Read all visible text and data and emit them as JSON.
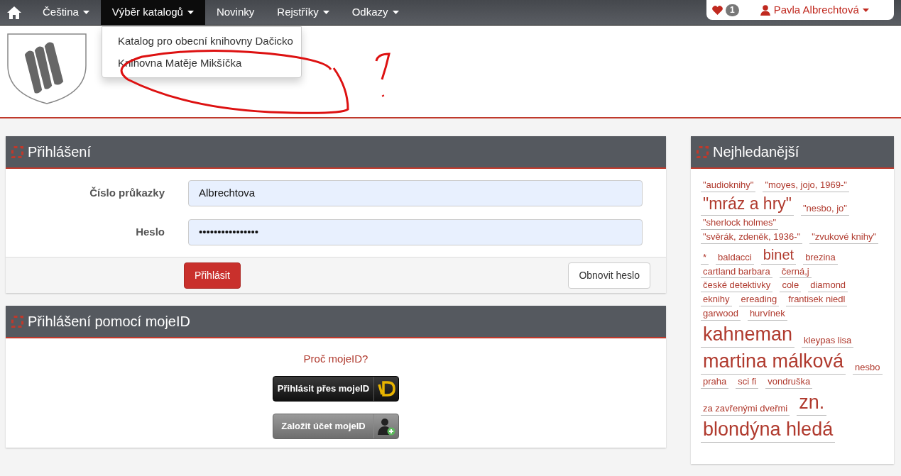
{
  "navbar": {
    "items": [
      {
        "label": "Čeština",
        "dropdown": true,
        "selected": false
      },
      {
        "label": "Výběr katalogů",
        "dropdown": true,
        "selected": true
      },
      {
        "label": "Novinky",
        "dropdown": false,
        "selected": false
      },
      {
        "label": "Rejstříky",
        "dropdown": true,
        "selected": false
      },
      {
        "label": "Odkazy",
        "dropdown": true,
        "selected": false
      }
    ],
    "favorites_count": "1",
    "user": "Pavla Albrechtová"
  },
  "catalog_menu": [
    "Katalog pro obecní knihovny Dačicko",
    "Knihovna Matěje Mikšíčka"
  ],
  "login": {
    "title": "Přihlášení",
    "fields": [
      {
        "label": "Číslo průkazky",
        "value": "Albrechtova"
      },
      {
        "label": "Heslo",
        "value": "••••••••••••••••"
      }
    ],
    "submit": "Přihlásit",
    "reset": "Obnovit heslo"
  },
  "mojeid": {
    "title": "Přihlášení pomocí mojeID",
    "why": "Proč mojeID?",
    "login_button": "Přihlásit přes mojeID",
    "register_button": "Založit účet mojeID"
  },
  "popular": {
    "title": "Nejhledanější",
    "tags": [
      {
        "label": "\"audioknihy\"",
        "kind": "small"
      },
      {
        "label": "\"moyes, jojo, 1969-\"",
        "kind": "small"
      },
      {
        "label": "\"mráz a hry\"",
        "kind": "large"
      },
      {
        "label": "\"nesbo, jo\"",
        "kind": "small"
      },
      {
        "label": "\"sherlock holmes\"",
        "kind": "small"
      },
      {
        "label": "\"svěrák, zdeněk, 1936-\"",
        "kind": "small"
      },
      {
        "label": "\"zvukové knihy\"",
        "kind": "small"
      },
      {
        "label": "*",
        "kind": "small"
      },
      {
        "label": "baldacci",
        "kind": "small"
      },
      {
        "label": "binet",
        "kind": "medium"
      },
      {
        "label": "brezina",
        "kind": "small"
      },
      {
        "label": "cartland barbara",
        "kind": "small"
      },
      {
        "label": "černá,j",
        "kind": "small"
      },
      {
        "label": "české detektivky",
        "kind": "small"
      },
      {
        "label": "cole",
        "kind": "small"
      },
      {
        "label": "diamond",
        "kind": "small"
      },
      {
        "label": "eknihy",
        "kind": "small"
      },
      {
        "label": "ereading",
        "kind": "small"
      },
      {
        "label": "frantisek niedl",
        "kind": "small"
      },
      {
        "label": "garwood",
        "kind": "small"
      },
      {
        "label": "hurvínek",
        "kind": "small"
      },
      {
        "label": "kahneman",
        "kind": "huge"
      },
      {
        "label": "kleypas lisa",
        "kind": "small"
      },
      {
        "label": "martina málková",
        "kind": "huge"
      },
      {
        "label": "nesbo",
        "kind": "small"
      },
      {
        "label": "praha",
        "kind": "small"
      },
      {
        "label": "sci fi",
        "kind": "small"
      },
      {
        "label": "vondruška",
        "kind": "small"
      },
      {
        "label": "za zavřenými dveřmi",
        "kind": "small"
      },
      {
        "label": "zn.",
        "kind": "huge"
      },
      {
        "label": "blondýna hledá",
        "kind": "huge"
      }
    ]
  }
}
